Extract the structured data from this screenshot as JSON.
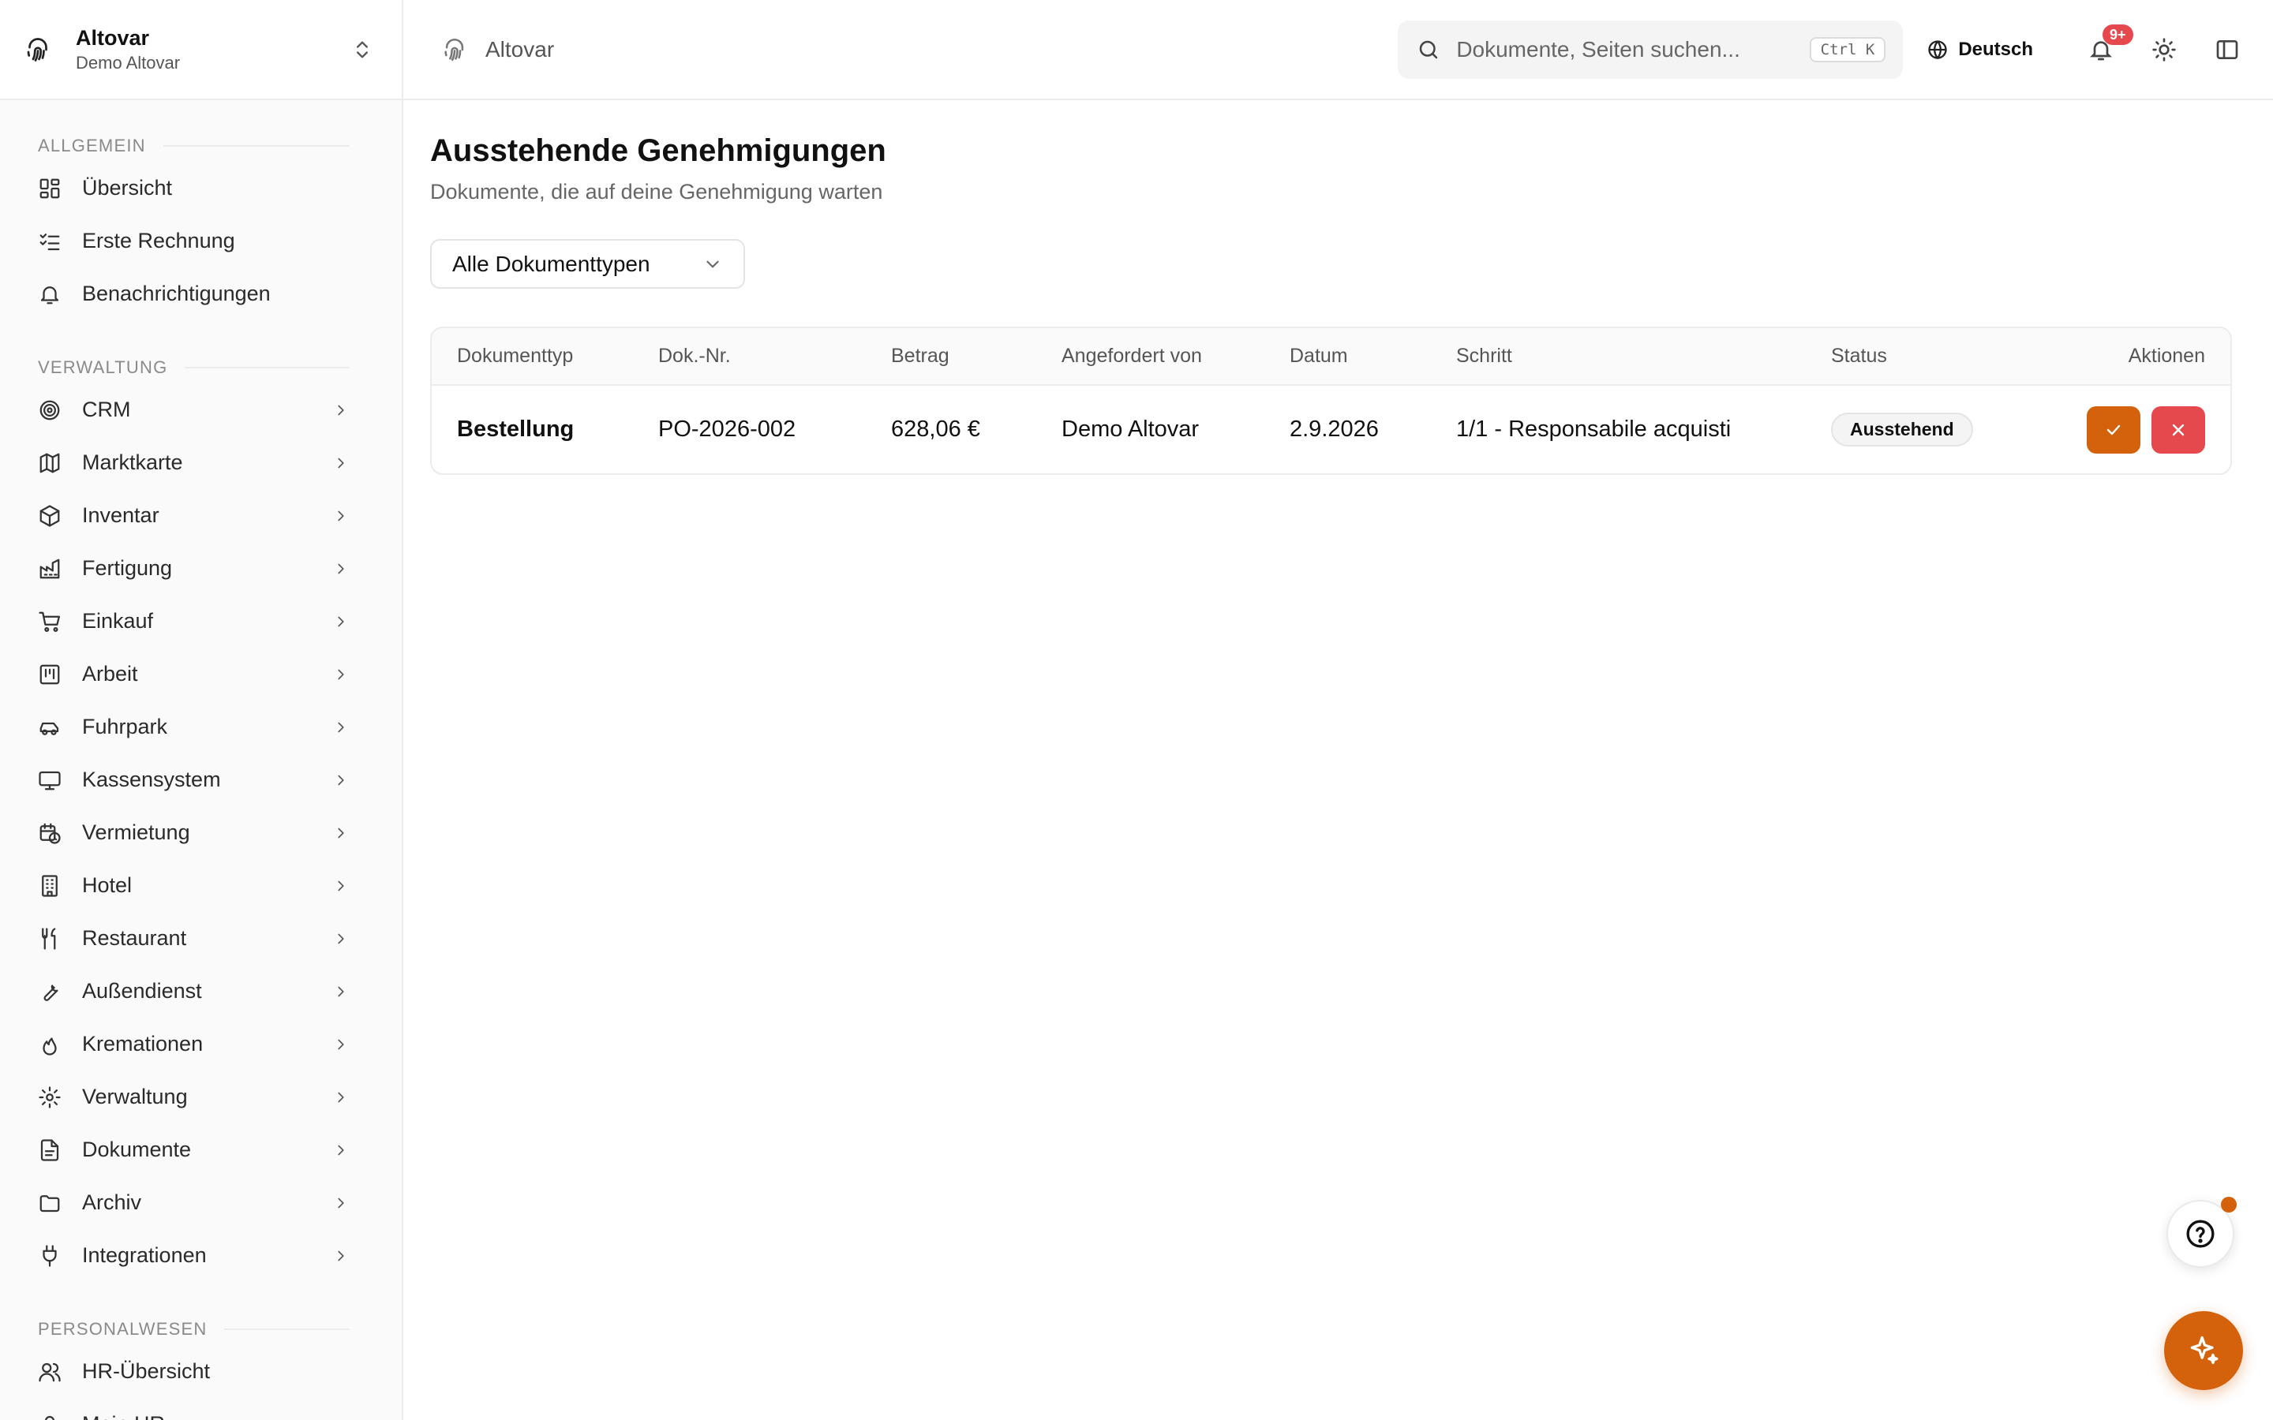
{
  "org": {
    "name": "Altovar",
    "subtitle": "Demo Altovar"
  },
  "sidebar": {
    "sections": [
      {
        "title": "Allgemein",
        "items": [
          {
            "label": "Übersicht",
            "icon": "dashboard-icon",
            "chevron": false
          },
          {
            "label": "Erste Rechnung",
            "icon": "checklist-icon",
            "chevron": false
          },
          {
            "label": "Benachrichtigungen",
            "icon": "bell-icon",
            "chevron": false
          }
        ]
      },
      {
        "title": "Verwaltung",
        "items": [
          {
            "label": "CRM",
            "icon": "target-icon",
            "chevron": true
          },
          {
            "label": "Marktkarte",
            "icon": "map-icon",
            "chevron": true
          },
          {
            "label": "Inventar",
            "icon": "box-icon",
            "chevron": true
          },
          {
            "label": "Fertigung",
            "icon": "factory-icon",
            "chevron": true
          },
          {
            "label": "Einkauf",
            "icon": "cart-icon",
            "chevron": true
          },
          {
            "label": "Arbeit",
            "icon": "kanban-icon",
            "chevron": true
          },
          {
            "label": "Fuhrpark",
            "icon": "car-icon",
            "chevron": true
          },
          {
            "label": "Kassensystem",
            "icon": "monitor-icon",
            "chevron": true
          },
          {
            "label": "Vermietung",
            "icon": "calendar-clock-icon",
            "chevron": true
          },
          {
            "label": "Hotel",
            "icon": "building-icon",
            "chevron": true
          },
          {
            "label": "Restaurant",
            "icon": "utensils-icon",
            "chevron": true
          },
          {
            "label": "Außendienst",
            "icon": "wrench-icon",
            "chevron": true
          },
          {
            "label": "Kremationen",
            "icon": "flame-icon",
            "chevron": true
          },
          {
            "label": "Verwaltung",
            "icon": "gear-icon",
            "chevron": true
          },
          {
            "label": "Dokumente",
            "icon": "file-icon",
            "chevron": true
          },
          {
            "label": "Archiv",
            "icon": "folder-icon",
            "chevron": true
          },
          {
            "label": "Integrationen",
            "icon": "plug-icon",
            "chevron": true
          }
        ]
      },
      {
        "title": "Personalwesen",
        "items": [
          {
            "label": "HR-Übersicht",
            "icon": "users-icon",
            "chevron": false
          },
          {
            "label": "Mein HR",
            "icon": "user-icon",
            "chevron": false
          }
        ]
      }
    ]
  },
  "topbar": {
    "breadcrumb": "Altovar",
    "search_placeholder": "Dokumente, Seiten suchen...",
    "search_shortcut": "Ctrl K",
    "language": "Deutsch",
    "notification_badge": "9+"
  },
  "page": {
    "title": "Ausstehende Genehmigungen",
    "subtitle": "Dokumente, die auf deine Genehmigung warten",
    "filter_value": "Alle Dokumenttypen"
  },
  "table": {
    "columns": [
      "Dokumenttyp",
      "Dok.-Nr.",
      "Betrag",
      "Angefordert von",
      "Datum",
      "Schritt",
      "Status",
      "Aktionen"
    ],
    "rows": [
      {
        "type": "Bestellung",
        "number": "PO-2026-002",
        "amount": "628,06 €",
        "requested_by": "Demo Altovar",
        "date": "2.9.2026",
        "step": "1/1 - Responsabile acquisti",
        "status": "Ausstehend"
      }
    ]
  },
  "colors": {
    "accent": "#d4620c",
    "danger": "#e5484d"
  }
}
